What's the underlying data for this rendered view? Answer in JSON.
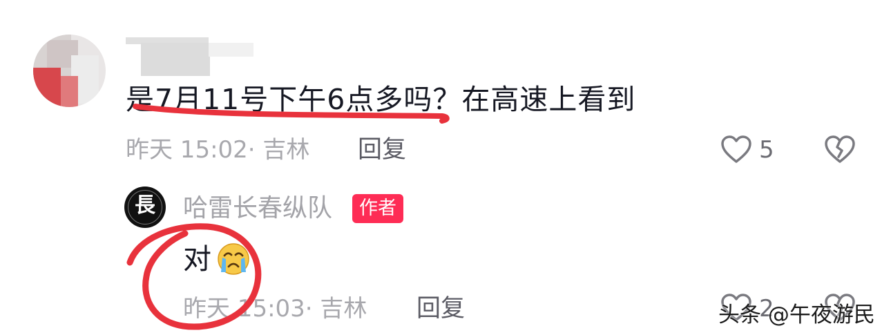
{
  "comment": {
    "text": "是7月11号下午6点多吗？在高速上看到",
    "meta": "昨天 15:02· 吉林",
    "reply_label": "回复",
    "like_count": "5"
  },
  "author_reply": {
    "name": "哈雷长春纵队",
    "badge": "作者",
    "text": "对",
    "avatar_glyph": "長",
    "meta": "昨天 15:03· 吉林",
    "reply_label": "回复",
    "like_count": "2"
  },
  "watermark": "头条 @午夜游民",
  "colors": {
    "annotation_red": "#e8323c",
    "author_badge": "#fe2c55",
    "meta_gray": "#a8a8ad"
  },
  "icons": [
    "heart-outline-icon",
    "broken-heart-icon",
    "crying-emoji-icon"
  ]
}
